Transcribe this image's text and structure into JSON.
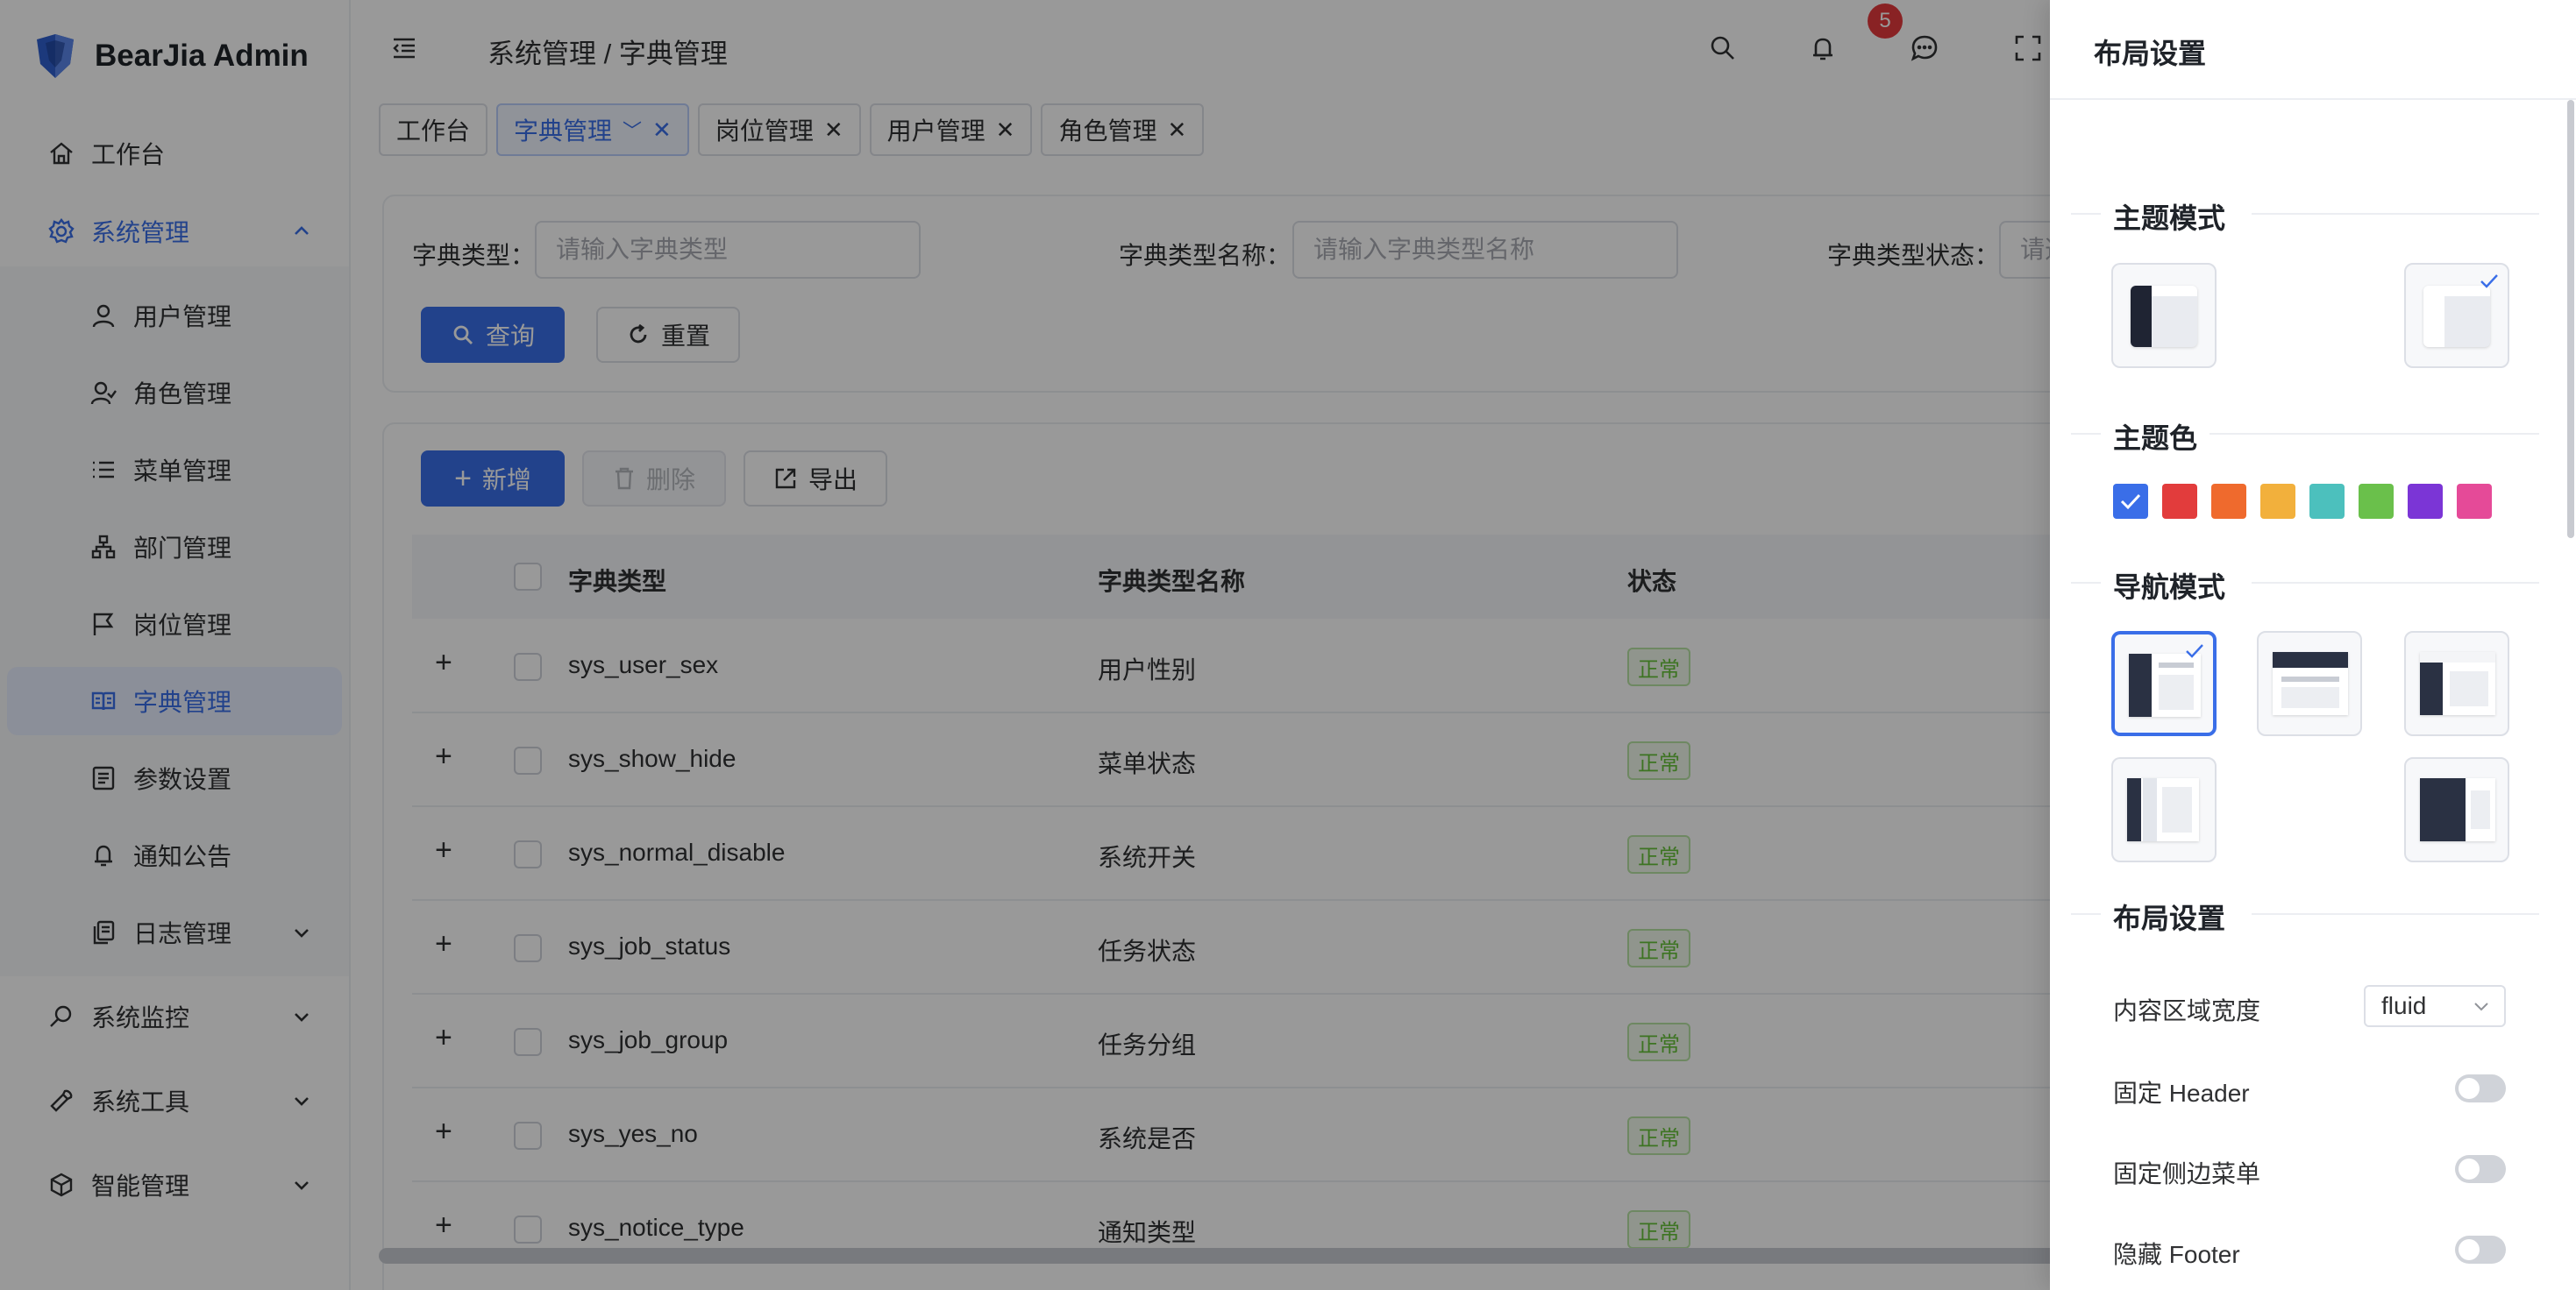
{
  "app": {
    "title": "BearJia Admin"
  },
  "sidebar": {
    "items": [
      {
        "label": "工作台",
        "icon": "home-icon"
      },
      {
        "label": "系统管理",
        "icon": "gear-icon",
        "expanded": true
      },
      {
        "label": "用户管理",
        "icon": "user-icon"
      },
      {
        "label": "角色管理",
        "icon": "role-icon"
      },
      {
        "label": "菜单管理",
        "icon": "list-icon"
      },
      {
        "label": "部门管理",
        "icon": "org-icon"
      },
      {
        "label": "岗位管理",
        "icon": "flag-icon"
      },
      {
        "label": "字典管理",
        "icon": "book-icon",
        "active": true
      },
      {
        "label": "参数设置",
        "icon": "doc-icon"
      },
      {
        "label": "通知公告",
        "icon": "bell-icon"
      },
      {
        "label": "日志管理",
        "icon": "log-icon"
      },
      {
        "label": "系统监控",
        "icon": "monitor-icon"
      },
      {
        "label": "系统工具",
        "icon": "tool-icon"
      },
      {
        "label": "智能管理",
        "icon": "cube-icon"
      }
    ]
  },
  "header": {
    "breadcrumb": "系统管理 / 字典管理",
    "notification_count": "5"
  },
  "tabs": [
    {
      "label": "工作台"
    },
    {
      "label": "字典管理",
      "active": true
    },
    {
      "label": "岗位管理"
    },
    {
      "label": "用户管理"
    },
    {
      "label": "角色管理"
    }
  ],
  "search": {
    "type_label": "字典类型：",
    "type_placeholder": "请输入字典类型",
    "name_label": "字典类型名称：",
    "name_placeholder": "请输入字典类型名称",
    "status_label": "字典类型状态：",
    "status_placeholder": "请选",
    "query_label": "查询",
    "reset_label": "重置"
  },
  "toolbar": {
    "add_label": "新增",
    "delete_label": "删除",
    "export_label": "导出"
  },
  "table": {
    "columns": [
      "字典类型",
      "字典类型名称",
      "状态"
    ],
    "rows": [
      {
        "type": "sys_user_sex",
        "name": "用户性别",
        "status": "正常"
      },
      {
        "type": "sys_show_hide",
        "name": "菜单状态",
        "status": "正常"
      },
      {
        "type": "sys_normal_disable",
        "name": "系统开关",
        "status": "正常"
      },
      {
        "type": "sys_job_status",
        "name": "任务状态",
        "status": "正常"
      },
      {
        "type": "sys_job_group",
        "name": "任务分组",
        "status": "正常"
      },
      {
        "type": "sys_yes_no",
        "name": "系统是否",
        "status": "正常"
      },
      {
        "type": "sys_notice_type",
        "name": "通知类型",
        "status": "正常"
      }
    ]
  },
  "drawer": {
    "title": "布局设置",
    "theme_mode_title": "主题模式",
    "theme_color_title": "主题色",
    "nav_mode_title": "导航模式",
    "layout_title": "布局设置",
    "theme_colors": [
      "#3a6ee8",
      "#e23c3c",
      "#ef6a2d",
      "#f2b03c",
      "#4cc0bd",
      "#6ac04b",
      "#7b35d6",
      "#e54a98"
    ],
    "content_width_label": "内容区域宽度",
    "content_width_value": "fluid",
    "fixed_header_label": "固定 Header",
    "fixed_sider_label": "固定侧边菜单",
    "hide_footer_label": "隐藏 Footer"
  }
}
